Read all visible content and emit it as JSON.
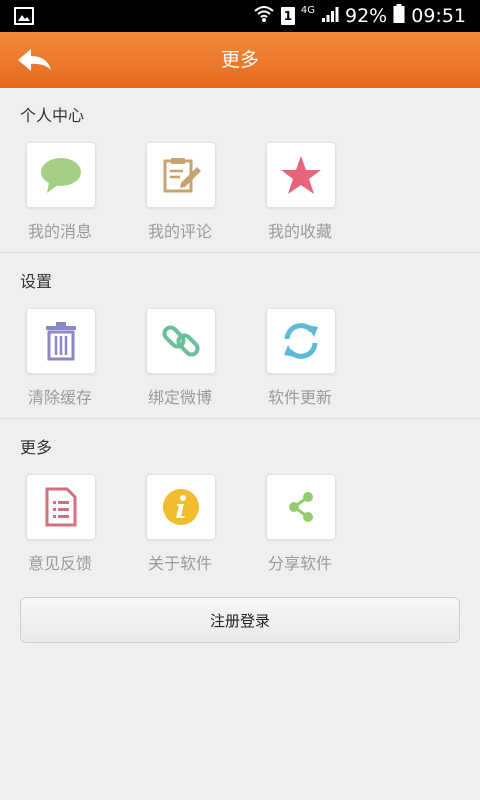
{
  "status_bar": {
    "network": "4G",
    "sim": "1",
    "battery": "92%",
    "time": "09:51"
  },
  "header": {
    "title": "更多"
  },
  "sections": [
    {
      "title": "个人中心",
      "items": [
        {
          "label": "我的消息",
          "icon": "chat-bubble-icon",
          "color": "#a5cf84"
        },
        {
          "label": "我的评论",
          "icon": "edit-note-icon",
          "color": "#c7a46f"
        },
        {
          "label": "我的收藏",
          "icon": "star-icon",
          "color": "#e8647a"
        }
      ]
    },
    {
      "title": "设置",
      "items": [
        {
          "label": "清除缓存",
          "icon": "trash-icon",
          "color": "#8a88c8"
        },
        {
          "label": "绑定微博",
          "icon": "link-icon",
          "color": "#6abf98"
        },
        {
          "label": "软件更新",
          "icon": "refresh-icon",
          "color": "#5bbbd6"
        }
      ]
    },
    {
      "title": "更多",
      "items": [
        {
          "label": "意见反馈",
          "icon": "document-icon",
          "color": "#d4707a"
        },
        {
          "label": "关于软件",
          "icon": "info-icon",
          "color": "#f3bc2c"
        },
        {
          "label": "分享软件",
          "icon": "share-icon",
          "color": "#93cd6a"
        }
      ]
    }
  ],
  "login_button": {
    "label": "注册登录"
  }
}
